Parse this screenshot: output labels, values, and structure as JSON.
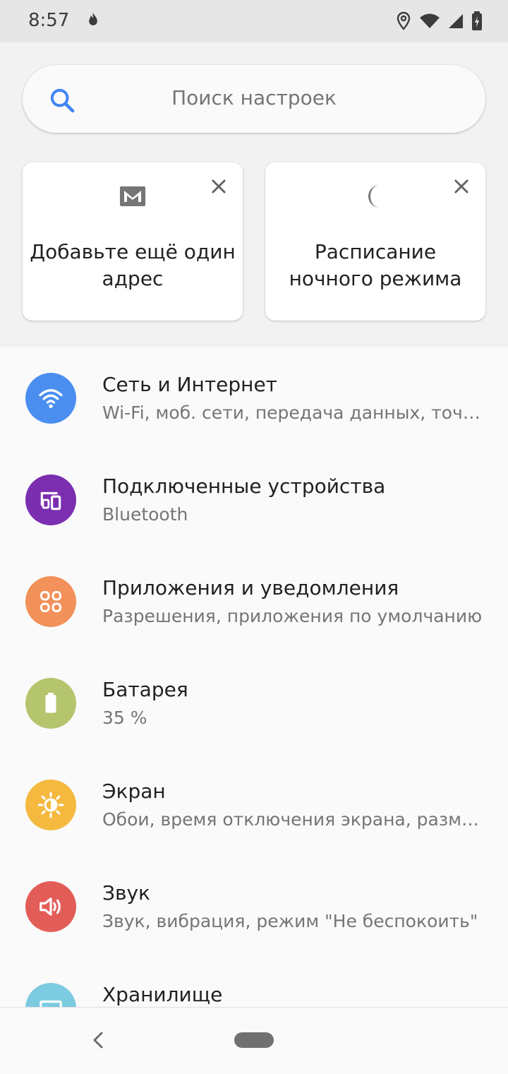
{
  "status_bar": {
    "time": "8:57",
    "icons": [
      "flame-icon",
      "location-icon",
      "wifi-icon",
      "cell-signal-icon",
      "battery-charging-icon"
    ]
  },
  "search": {
    "placeholder": "Поиск настроек",
    "icon": "search-icon"
  },
  "suggestions": [
    {
      "text": "Добавьте ещё один адрес",
      "icon": "gmail-icon"
    },
    {
      "text": "Расписание ночного режима",
      "icon": "moon-icon"
    }
  ],
  "settings": [
    {
      "title": "Сеть и Интернет",
      "subtitle": "Wi-Fi, моб. сети, передача данных, точк…",
      "icon": "wifi-icon",
      "color": "#4a8ff0"
    },
    {
      "title": "Подключенные устройства",
      "subtitle": "Bluetooth",
      "icon": "devices-icon",
      "color": "#7b2fb0"
    },
    {
      "title": "Приложения и уведомления",
      "subtitle": "Разрешения, приложения по умолчанию",
      "icon": "apps-icon",
      "color": "#f29159"
    },
    {
      "title": "Батарея",
      "subtitle": "35 %",
      "icon": "battery-icon",
      "color": "#b5c56d"
    },
    {
      "title": "Экран",
      "subtitle": "Обои, время отключения экрана, разм…",
      "icon": "brightness-icon",
      "color": "#f5b940"
    },
    {
      "title": "Звук",
      "subtitle": "Звук, вибрация, режим \"Не беспокоить\"",
      "icon": "volume-icon",
      "color": "#e35d58"
    },
    {
      "title": "Хранилище",
      "subtitle": "",
      "icon": "storage-icon",
      "color": "#7ccbe0"
    }
  ],
  "nav": {
    "icons": [
      "back-icon",
      "home-pill"
    ]
  }
}
